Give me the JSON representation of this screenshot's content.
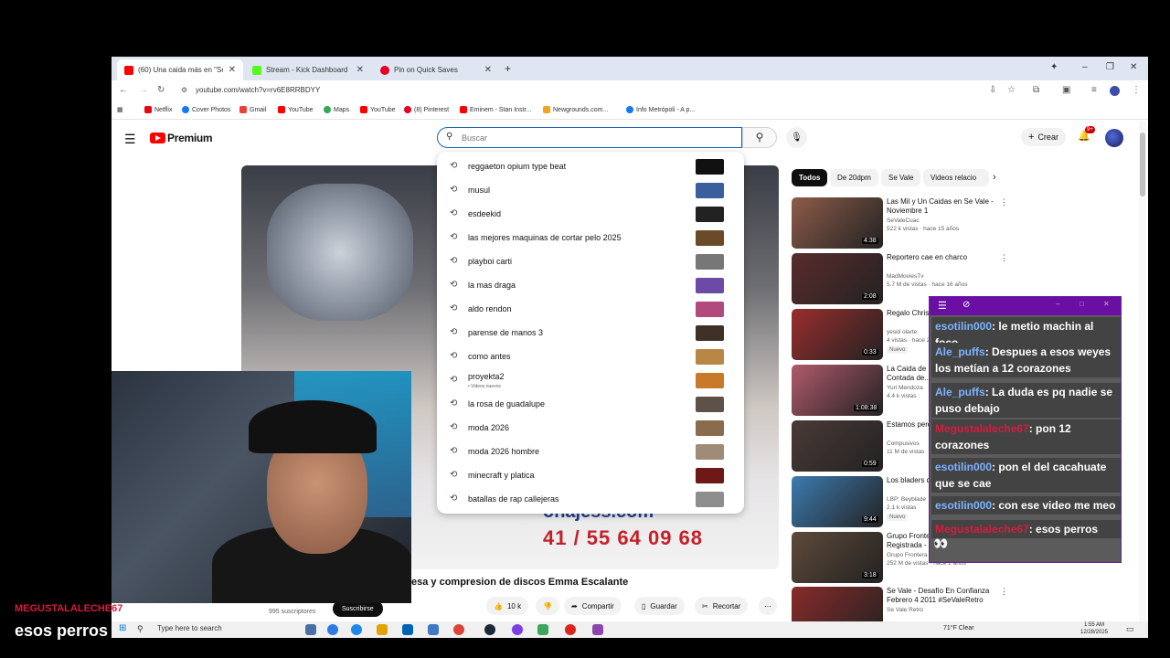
{
  "tabs": [
    {
      "title": "(60) Una caida más en \"Se Vale",
      "color": "#ff0000"
    },
    {
      "title": "Stream - Kick Dashboard",
      "color": "#53fc18"
    },
    {
      "title": "Pin on Quick Saves",
      "color": "#e60023"
    }
  ],
  "address": {
    "url": "youtube.com/watch?v=rv6E8RRBDYY"
  },
  "bookmarks": [
    "Netflix",
    "Cover Photos",
    "Gmail",
    "YouTube",
    "Maps",
    "YouTube",
    "(8) Pinterest",
    "Eminem - Stan Instr...",
    "Newgrounds.com...",
    "Info Metrópoli - A p..."
  ],
  "youtube": {
    "logo": "Premium",
    "search_placeholder": "Buscar",
    "create_label": "Crear",
    "notif_count": "9+"
  },
  "suggestions": [
    {
      "q": "reggaeton opium type beat",
      "c": "#111"
    },
    {
      "q": "musul",
      "c": "#3a5f9c"
    },
    {
      "q": "esdeekid",
      "c": "#222"
    },
    {
      "q": "las mejores maquinas de cortar pelo 2025",
      "c": "#6b4a2a"
    },
    {
      "q": "playboi carti",
      "c": "#777"
    },
    {
      "q": "la mas draga",
      "c": "#6d4aa5"
    },
    {
      "q": "aldo rendon",
      "c": "#b34a7d"
    },
    {
      "q": "parense de manos 3",
      "c": "#3e3027"
    },
    {
      "q": "como antes",
      "c": "#b88746"
    },
    {
      "q": "proyekta2",
      "c": "#c87a2a",
      "sub": "• Videos nuevos"
    },
    {
      "q": "la rosa de guadalupe",
      "c": "#5d5149"
    },
    {
      "q": "moda 2026",
      "c": "#8a6b4e"
    },
    {
      "q": "moda 2026 hombre",
      "c": "#a08a78"
    },
    {
      "q": "minecraft y platica",
      "c": "#6e1818"
    },
    {
      "q": "batallas de rap callejeras",
      "c": "#8d8d8d"
    }
  ],
  "chips": [
    "Todos",
    "De 20dpm",
    "Se Vale",
    "Videos relacio"
  ],
  "recommended": [
    {
      "title": "Las Mil y Un Caidas en Se Vale - Noviembre 1",
      "channel": "SeValeCuac",
      "meta": "522 k vistas · hace 15 años",
      "dur": "4:38",
      "c": "#8d5c4a"
    },
    {
      "title": "Reportero cae en charco",
      "channel": "MadMoviesTv",
      "meta": "5.7 M de vistas · hace 16 años",
      "dur": "2:08",
      "c": "#5a2c2c"
    },
    {
      "title": "Regalo Chris",
      "channel": "yesid olarte",
      "meta": "4 vistas · hace 2 horas",
      "dur": "0:33",
      "c": "#9a2d2d",
      "nuevo": "Nuevo"
    },
    {
      "title": "La Caida de Historia Nunca Contada de...",
      "channel": "Yuri Mendoza",
      "meta": "4.4 k vistas",
      "dur": "1:08:38",
      "c": "#b05a6b"
    },
    {
      "title": "Estamos perd... original",
      "channel": "Compusivos",
      "meta": "11 M de vistas",
      "dur": "0:59",
      "c": "#4a3a35"
    },
    {
      "title": "Los bladers de la historia",
      "channel": "LBP: Beyblade",
      "meta": "2.1 k vistas",
      "dur": "9:44",
      "c": "#3d7bb0",
      "nuevo": "Nuevo"
    },
    {
      "title": "Grupo Frontera, Grupo Marca Registrada - Dime Si (Video",
      "channel": "Grupo Frontera",
      "meta": "252 M de vistas · hace 2 años",
      "dur": "3:18",
      "c": "#5e4a3a"
    },
    {
      "title": "Se Vale - Desafío En Confianza Febrero 4 2011 #SeValeRetro",
      "channel": "Se Vale Retro",
      "meta": "",
      "dur": "",
      "c": "#8a2a2a"
    }
  ],
  "video": {
    "title": "esa y compresion de discos Emma Escalante",
    "site": "onajess.com",
    "phone": "41 / 55 64 09 68",
    "likes": "10 k",
    "share": "Compartir",
    "save": "Guardar",
    "clip": "Recortar",
    "subs": "995 suscriptores",
    "subscribe": "Suscribirse"
  },
  "chat": [
    {
      "user": "esotilin000",
      "text": ": le metio machin al foco",
      "uc": "#7ab4ff"
    },
    {
      "user": "Ale_puffs",
      "text": ": Despues a esos weyes los metían a 12 corazones",
      "uc": "#7ab4ff"
    },
    {
      "user": "Ale_puffs",
      "text": ": La duda es pq nadie se puso debajo",
      "uc": "#7ab4ff"
    },
    {
      "user": "Megustalaleche67",
      "text": ": pon 12 corazones",
      "uc": "#d81b3d"
    },
    {
      "user": "esotilin000",
      "text": ": pon el del cacahuate que se cae",
      "uc": "#7ab4ff"
    },
    {
      "user": "esotilin000",
      "text": ": con ese video me meo",
      "uc": "#7ab4ff"
    },
    {
      "user": "Megustalaleche67",
      "text": ": esos perros",
      "uc": "#d81b3d"
    }
  ],
  "caption": {
    "user": "MEGUSTALALECHE67",
    "msg": "esos perros"
  },
  "taskbar": {
    "search": "Type here to search",
    "weather": "71°F  Clear",
    "time": "1:55 AM",
    "date": "12/28/2025"
  }
}
